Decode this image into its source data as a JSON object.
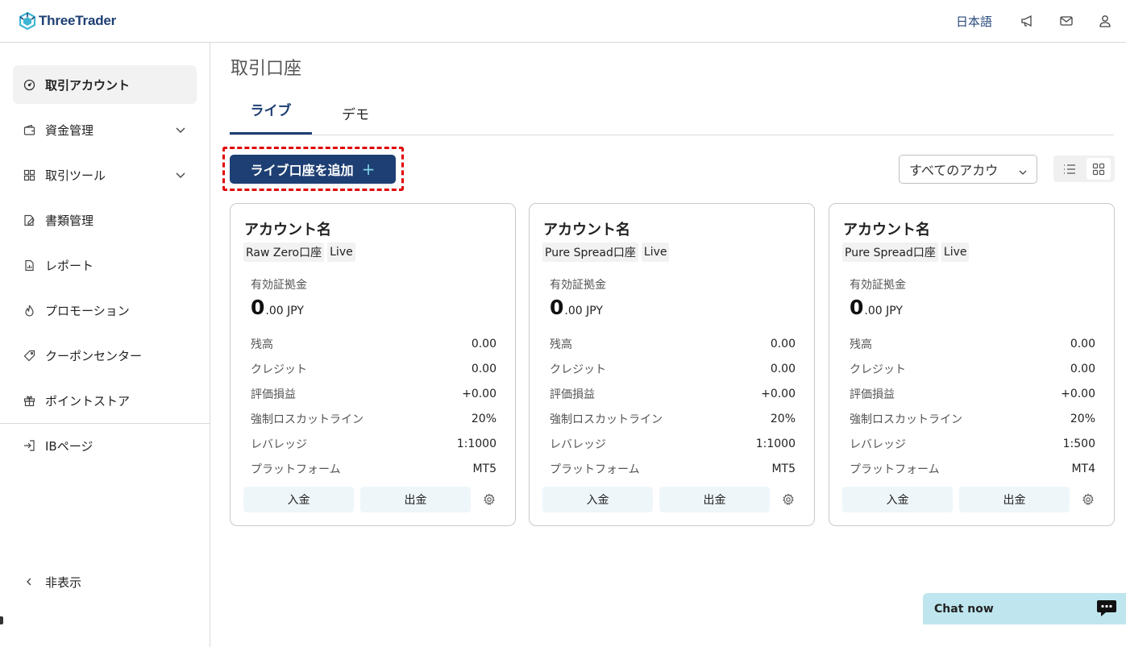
{
  "header": {
    "logo_text": "ThreeTrader",
    "language": "日本語",
    "icons": [
      "megaphone-icon",
      "mail-icon",
      "user-icon"
    ]
  },
  "sidebar": {
    "items": [
      {
        "label": "取引アカウント",
        "icon": "gauge-icon",
        "active": true
      },
      {
        "label": "資金管理",
        "icon": "wallet-icon",
        "expandable": true
      },
      {
        "label": "取引ツール",
        "icon": "tools-icon",
        "expandable": true
      },
      {
        "label": "書類管理",
        "icon": "document-edit-icon"
      },
      {
        "label": "レポート",
        "icon": "report-icon"
      },
      {
        "label": "プロモーション",
        "icon": "flame-icon"
      },
      {
        "label": "クーポンセンター",
        "icon": "tag-icon"
      },
      {
        "label": "ポイントストア",
        "icon": "gift-icon"
      }
    ],
    "ib_page": "IBページ",
    "hide": "非表示"
  },
  "main": {
    "title": "取引口座",
    "tabs": [
      {
        "label": "ライブ",
        "active": true
      },
      {
        "label": "デモ",
        "active": false
      }
    ],
    "add_button": "ライブ口座を追加",
    "add_button_icon": "+",
    "filter": "すべてのアカウ",
    "accent_color": "#1e3f73",
    "highlight_color": "#e00000"
  },
  "cards": [
    {
      "name": "アカウント名",
      "tags": [
        "Raw Zero口座",
        "Live"
      ],
      "margin_label": "有効証拠金",
      "margin_int": "0",
      "margin_rest": ".00 JPY",
      "rows": [
        {
          "k": "残高",
          "v": "0.00"
        },
        {
          "k": "クレジット",
          "v": "0.00"
        },
        {
          "k": "評価損益",
          "v": "+0.00"
        },
        {
          "k": "強制ロスカットライン",
          "v": "20%"
        },
        {
          "k": "レバレッジ",
          "v": "1:1000"
        },
        {
          "k": "プラットフォーム",
          "v": "MT5"
        }
      ],
      "deposit": "入金",
      "withdraw": "出金"
    },
    {
      "name": "アカウント名",
      "tags": [
        "Pure Spread口座",
        "Live"
      ],
      "margin_label": "有効証拠金",
      "margin_int": "0",
      "margin_rest": ".00 JPY",
      "rows": [
        {
          "k": "残高",
          "v": "0.00"
        },
        {
          "k": "クレジット",
          "v": "0.00"
        },
        {
          "k": "評価損益",
          "v": "+0.00"
        },
        {
          "k": "強制ロスカットライン",
          "v": "20%"
        },
        {
          "k": "レバレッジ",
          "v": "1:1000"
        },
        {
          "k": "プラットフォーム",
          "v": "MT5"
        }
      ],
      "deposit": "入金",
      "withdraw": "出金"
    },
    {
      "name": "アカウント名",
      "tags": [
        "Pure Spread口座",
        "Live"
      ],
      "margin_label": "有効証拠金",
      "margin_int": "0",
      "margin_rest": ".00 JPY",
      "rows": [
        {
          "k": "残高",
          "v": "0.00"
        },
        {
          "k": "クレジット",
          "v": "0.00"
        },
        {
          "k": "評価損益",
          "v": "+0.00"
        },
        {
          "k": "強制ロスカットライン",
          "v": "20%"
        },
        {
          "k": "レバレッジ",
          "v": "1:500"
        },
        {
          "k": "プラットフォーム",
          "v": "MT4"
        }
      ],
      "deposit": "入金",
      "withdraw": "出金"
    }
  ],
  "chat": {
    "label": "Chat now",
    "icon": "chat-bubble-icon"
  }
}
